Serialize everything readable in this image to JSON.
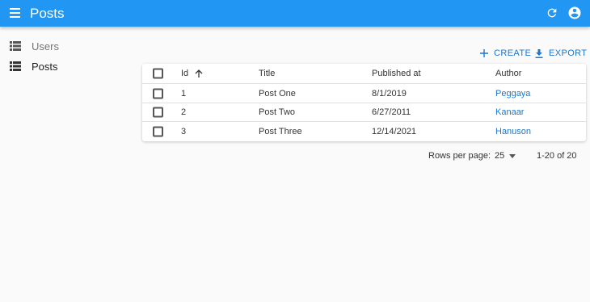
{
  "appbar": {
    "title": "Posts",
    "color": "#2196f3",
    "icons": {
      "menu": "menu-icon",
      "refresh": "refresh-icon",
      "account": "account-circle-icon"
    }
  },
  "sidebar": {
    "items": [
      {
        "label": "Users",
        "icon": "list-icon",
        "active": false
      },
      {
        "label": "Posts",
        "icon": "list-icon",
        "active": true
      }
    ]
  },
  "toolbar": {
    "create_label": "CREATE",
    "export_label": "EXPORT",
    "accent": "#1976d2"
  },
  "table": {
    "columns": [
      "Id",
      "Title",
      "Published at",
      "Author"
    ],
    "sort": {
      "column": "Id",
      "direction": "asc"
    },
    "rows": [
      {
        "id": "1",
        "title": "Post One",
        "published_at": "8/1/2019",
        "author": "Peggaya"
      },
      {
        "id": "2",
        "title": "Post Two",
        "published_at": "6/27/2011",
        "author": "Kanaar"
      },
      {
        "id": "3",
        "title": "Post Three",
        "published_at": "12/14/2021",
        "author": "Hanuson"
      }
    ]
  },
  "pagination": {
    "rows_per_page_label": "Rows per page:",
    "rows_per_page_value": "25",
    "range": "1-20 of 20"
  }
}
